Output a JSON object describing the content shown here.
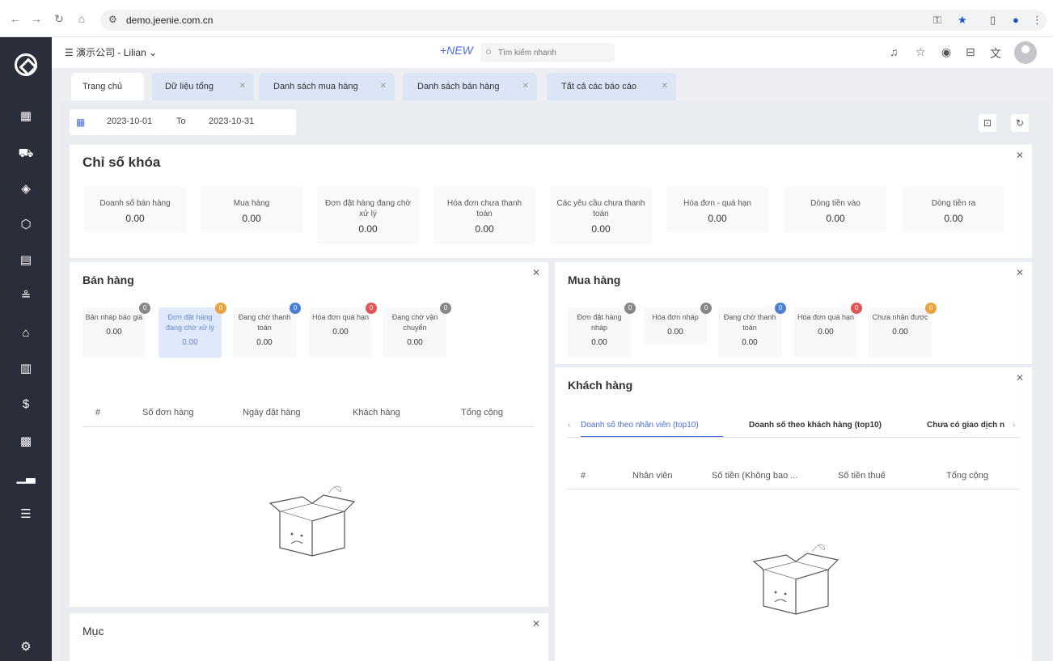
{
  "browser": {
    "url": "demo.jeenie.com.cn"
  },
  "topbar": {
    "company": "演示公司 - Lilian",
    "new_label": "+NEW",
    "search_placeholder": "Tìm kiếm nhanh"
  },
  "tabs": [
    {
      "label": "Trang chủ"
    },
    {
      "label": "Dữ liệu tổng"
    },
    {
      "label": "Danh sách mua hàng"
    },
    {
      "label": "Danh sách bán hàng"
    },
    {
      "label": "Tất cả các báo cáo"
    }
  ],
  "daterange": {
    "from": "2023-10-01",
    "to_label": "To",
    "to": "2023-10-31"
  },
  "kpi": {
    "title": "Chỉ số khóa",
    "items": [
      {
        "label": "Doanh số bán hàng",
        "value": "0.00"
      },
      {
        "label": "Mua hàng",
        "value": "0.00"
      },
      {
        "label": "Đơn đặt hàng đang chờ xử lý",
        "value": "0.00"
      },
      {
        "label": "Hóa đơn chưa thanh toán",
        "value": "0.00"
      },
      {
        "label": "Các yêu cầu chưa thanh toán",
        "value": "0.00"
      },
      {
        "label": "Hóa đơn - quá hạn",
        "value": "0.00"
      },
      {
        "label": "Dòng tiền vào",
        "value": "0.00"
      },
      {
        "label": "Dòng tiền ra",
        "value": "0.00"
      }
    ]
  },
  "sales": {
    "title": "Bán hàng",
    "items": [
      {
        "label": "Bản nháp báo giá",
        "value": "0.00",
        "badge": "0",
        "color": "#888888"
      },
      {
        "label": "Đơn đặt hàng đang chờ xử lý",
        "value": "0.00",
        "badge": "0",
        "color": "#e8a33d"
      },
      {
        "label": "Đang chờ thanh toán",
        "value": "0.00",
        "badge": "0",
        "color": "#4a7fd6"
      },
      {
        "label": "Hóa đơn quá hạn",
        "value": "0.00",
        "badge": "0",
        "color": "#e05555"
      },
      {
        "label": "Đang chờ vận chuyển",
        "value": "0.00",
        "badge": "0",
        "color": "#888888"
      }
    ],
    "columns": [
      "#",
      "Số đơn hàng",
      "Ngày đặt hàng",
      "Khách hàng",
      "Tổng cộng"
    ]
  },
  "purchase": {
    "title": "Mua hàng",
    "items": [
      {
        "label": "Đơn đặt hàng nháp",
        "value": "0.00",
        "badge": "0",
        "color": "#888888"
      },
      {
        "label": "Hóa đơn nháp",
        "value": "0.00",
        "badge": "0",
        "color": "#888888"
      },
      {
        "label": "Đang chờ thanh toán",
        "value": "0.00",
        "badge": "0",
        "color": "#4a7fd6"
      },
      {
        "label": "Hóa đơn quá hạn",
        "value": "0.00",
        "badge": "0",
        "color": "#e05555"
      },
      {
        "label": "Chưa nhận được",
        "value": "0.00",
        "badge": "0",
        "color": "#e8a33d"
      }
    ]
  },
  "customers": {
    "title": "Khách hàng",
    "subtabs": [
      "Doanh số theo nhân viên (top10)",
      "Doanh số theo khách hàng (top10)",
      "Chưa có giao dịch n"
    ],
    "columns": [
      "#",
      "Nhân viên",
      "Số tiền (Không bao ...",
      "Số tiền thuế",
      "Tổng cộng"
    ]
  },
  "items_card": {
    "title": "Mục"
  },
  "icons": [
    "back-icon",
    "forward-icon",
    "reload-icon",
    "home-icon",
    "site-info-icon",
    "key-icon",
    "star-icon",
    "sidebar-icon",
    "profile-icon",
    "menu-icon",
    "bell-icon",
    "favorite-icon",
    "box-icon",
    "briefcase-icon",
    "translate-icon",
    "calendar-icon",
    "close-icon"
  ],
  "colors": {
    "sidebar": "#2a2e3a",
    "accent": "#4a6fd6",
    "tab_inactive": "#dbe5f5"
  }
}
